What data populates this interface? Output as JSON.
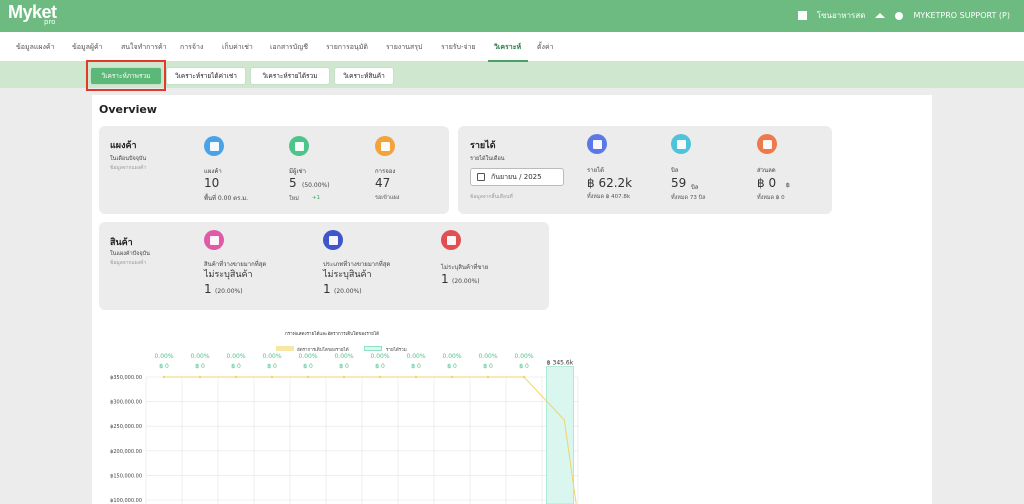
{
  "app": {
    "logo": "Myket",
    "logo_sub": "pro"
  },
  "topbar": {
    "store": "โซนอาหารสด",
    "user": "MYKETPRO SUPPORT (P)"
  },
  "menu": [
    "ข้อมูลแผงค้า",
    "ข้อมูลผู้ค้า",
    "สนใจทำการค้า",
    "การจ้าง",
    "เก็บค่าเช่า",
    "เอกสารบัญชี",
    "รายการอนุมัติ",
    "รายงานสรุป",
    "รายรับ-จ่าย",
    "วิเคราะห์",
    "ตั้งค่า"
  ],
  "subtabs": [
    "วิเคราะห์ภาพรวม",
    "วิเคราะห์รายได้ค่าเช่า",
    "วิเคราะห์รายได้รวม",
    "วิเคราะห์สินค้า"
  ],
  "overview_title": "Overview",
  "stalls_card": {
    "title": "แผงค้า",
    "sub": "ในเดือนปัจจุบัน",
    "sub2": "ข้อมูลจากแผงค้า",
    "items": [
      {
        "label": "แผงค้า",
        "value": "10",
        "detail": "พื้นที่ 0.00 ตร.ม.",
        "icon": "grid-icon",
        "color": "#4aa3e8"
      },
      {
        "label": "มีผู้เช่า",
        "value": "5",
        "pct": "(50.00%)",
        "detail": "ใหม่",
        "detail_value": "+1",
        "icon": "home-icon",
        "color": "#4cc48a"
      },
      {
        "label": "การจอง",
        "value": "47",
        "detail": "รอเข้าแผง",
        "icon": "booking-icon",
        "color": "#f0a43a"
      }
    ]
  },
  "income_card": {
    "title": "รายได้",
    "sub": "รายได้ในเดือน",
    "sub2": "ข้อมูลจากสิ้นเดือนที่",
    "month": "กันยายน / 2025",
    "items": [
      {
        "label": "รายได้",
        "value": "฿ 62.2k",
        "detail": "ทั้งหมด ฿ 407.8k",
        "icon": "money-icon",
        "color": "#5b78e6"
      },
      {
        "label": "บิล",
        "value": "59",
        "unit": "บิล",
        "detail": "ทั้งหมด 73 บิล",
        "icon": "bill-icon",
        "color": "#4ec3d9"
      },
      {
        "label": "ส่วนลด",
        "value": "฿ 0",
        "unit": "฿",
        "detail": "ทั้งหมด ฿ 0",
        "icon": "discount-icon",
        "color": "#ee7a4c"
      }
    ]
  },
  "products_card": {
    "title": "สินค้า",
    "sub": "ในแผงค้าปัจจุบัน",
    "sub2": "ข้อมูลจากแผงค้า",
    "items": [
      {
        "label": "สินค้าที่วางขายมากที่สุด",
        "name": "ไม่ระบุสินค้า",
        "value": "1",
        "pct": "(20.00%)",
        "icon": "store-icon",
        "color": "#e05aa8"
      },
      {
        "label": "ประเภทที่วางขายมากที่สุด",
        "name": "ไม่ระบุสินค้า",
        "value": "1",
        "pct": "(20.00%)",
        "icon": "category-icon",
        "color": "#3f55c9"
      },
      {
        "label": "ไม่ระบุสินค้าที่ขาย",
        "name": "",
        "value": "1",
        "pct": "(20.00%)",
        "icon": "no-product-icon",
        "color": "#e05050"
      }
    ]
  },
  "chart_data": {
    "type": "bar",
    "title": "กราฟแสดงรายได้และอัตราการเติบโตของรายได้",
    "legend": [
      "อัตราการเติบโตของรายได้",
      "รายได้รวม"
    ],
    "y_ticks": [
      "฿350,000.00",
      "฿300,000.00",
      "฿250,000.00",
      "฿200,000.00",
      "฿150,000.00",
      "฿100,000.00"
    ],
    "categories": [
      "",
      "",
      "",
      "",
      "",
      "",
      "",
      "",
      "",
      "",
      "",
      ""
    ],
    "values": [
      0,
      0,
      0,
      0,
      0,
      0,
      0,
      0,
      0,
      0,
      0,
      345600
    ],
    "growth_pct": [
      "0.00%",
      "0.00%",
      "0.00%",
      "0.00%",
      "0.00%",
      "0.00%",
      "0.00%",
      "0.00%",
      "0.00%",
      "0.00%",
      "0.00%"
    ],
    "growth_val": [
      "฿ 0",
      "฿ 0",
      "฿ 0",
      "฿ 0",
      "฿ 0",
      "฿ 0",
      "฿ 0",
      "฿ 0",
      "฿ 0",
      "฿ 0",
      "฿ 0"
    ],
    "peak_label": "฿ 345.6k",
    "ylim": [
      0,
      350000
    ],
    "colors": {
      "bar": "#d9f7ee",
      "bar_border": "#8fe0c6",
      "line": "#f2d36b"
    }
  }
}
